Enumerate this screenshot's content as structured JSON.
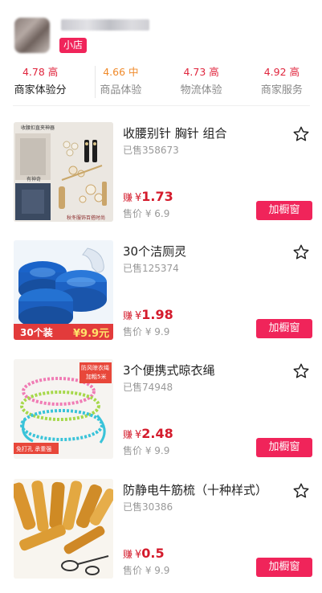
{
  "shop": {
    "badge": "小店"
  },
  "ratings": [
    {
      "score": "4.78 高",
      "label": "商家体验分"
    },
    {
      "score": "4.66 中",
      "label": "商品体验"
    },
    {
      "score": "4.73 高",
      "label": "物流体验"
    },
    {
      "score": "4.92 高",
      "label": "商家服务"
    }
  ],
  "products": [
    {
      "title": "收腰别针 胸针 组合",
      "sold": "已售358673",
      "earn_prefix": "赚",
      "currency": "¥",
      "earn_value": "1.73",
      "price": "售价 ¥ 6.9",
      "button": "加橱窗",
      "image_text": [
        "收腰扣直夹神器",
        "有神奇",
        "秋冬服饰百搭时尚"
      ]
    },
    {
      "title": "30个洁厕灵",
      "sold": "已售125374",
      "earn_prefix": "赚",
      "currency": "¥",
      "earn_value": "1.98",
      "price": "售价 ¥ 9.9",
      "button": "加橱窗",
      "image_text": [
        "30个装",
        "¥9.9元"
      ]
    },
    {
      "title": "3个便携式晾衣绳",
      "sold": "已售74948",
      "earn_prefix": "赚",
      "currency": "¥",
      "earn_value": "2.48",
      "price": "售价 ¥ 9.9",
      "button": "加橱窗",
      "image_text": [
        "防风晾衣绳",
        "加粗5米",
        "免打孔 承重强"
      ]
    },
    {
      "title": "防静电牛筋梳（十种样式）",
      "sold": "已售30386",
      "earn_prefix": "赚",
      "currency": "¥",
      "earn_value": "0.5",
      "price": "售价 ¥ 9.9",
      "button": "加橱窗",
      "image_text": []
    }
  ],
  "colors": {
    "accent": "#f0245a",
    "earn": "#d41b2c",
    "rating_high": "#e0263e",
    "rating_mid": "#f08a2a"
  }
}
